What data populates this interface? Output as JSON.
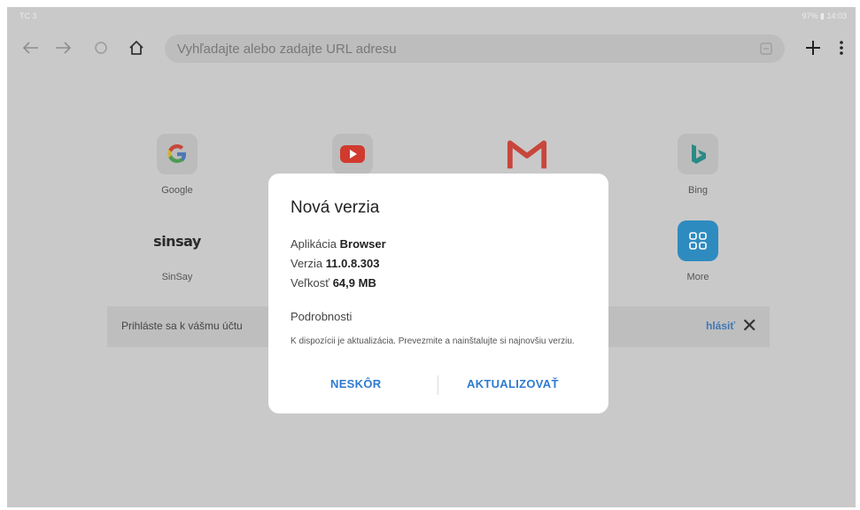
{
  "status": {
    "left": "TC 3",
    "right": "97% ▮ 14:03"
  },
  "toolbar": {
    "url_placeholder": "Vyhľadajte alebo zadajte URL adresu"
  },
  "speed_dial": [
    {
      "label": "Google",
      "icon": "google-icon"
    },
    {
      "label": "",
      "icon": "youtube-icon"
    },
    {
      "label": "",
      "icon": "gmail-icon"
    },
    {
      "label": "Bing",
      "icon": "bing-icon"
    },
    {
      "label": "SinSay",
      "logo_text": "sinsay",
      "icon": "sinsay-icon"
    },
    {
      "label": "More",
      "icon": "more-apps-icon"
    }
  ],
  "signin": {
    "text": "Prihláste sa k vášmu účtu",
    "link": "hlásiť"
  },
  "dialog": {
    "title": "Nová verzia",
    "app_label": "Aplikácia",
    "app_value": "Browser",
    "version_label": "Verzia",
    "version_value": "11.0.8.303",
    "size_label": "Veľkosť",
    "size_value": "64,9 MB",
    "details_heading": "Podrobnosti",
    "details_text": "K dispozícii je aktualizácia. Prevezmite a nainštalujte si najnovšiu verziu.",
    "later_button": "NESKÔR",
    "update_button": "AKTUALIZOVAŤ"
  },
  "colors": {
    "accent": "#2d7bd0",
    "scrim": "#c9c9c9"
  }
}
